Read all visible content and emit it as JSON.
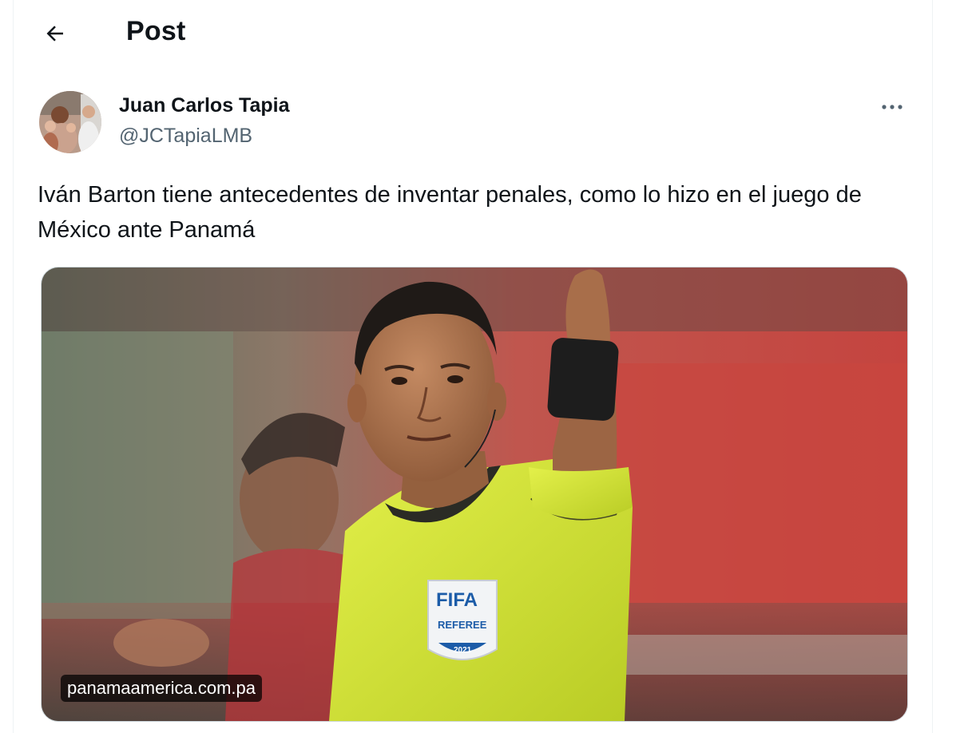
{
  "header": {
    "title": "Post",
    "back_icon": "arrow-left-icon"
  },
  "author": {
    "display_name": "Juan Carlos Tapia",
    "handle": "@JCTapiaLMB"
  },
  "post": {
    "text": "Iván Barton tiene antecedentes de inventar penales, como lo hizo en el juego de México ante Panamá",
    "more_icon": "more-horizontal-icon"
  },
  "media": {
    "source_label": "panamaamerica.com.pa",
    "badge_text": "FIFA",
    "badge_sub": "REFEREE",
    "badge_year": "2021"
  },
  "colors": {
    "text_primary": "#0f1419",
    "text_secondary": "#536471",
    "border": "#eff3f4",
    "jersey": "#d8ea3a"
  }
}
